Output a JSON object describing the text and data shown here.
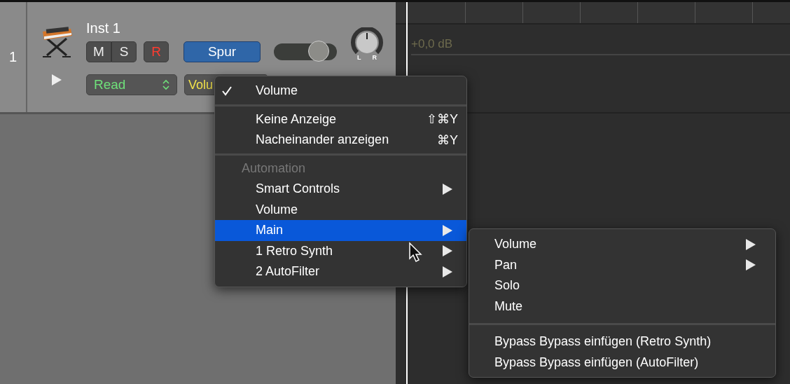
{
  "track": {
    "number": "1",
    "name": "Inst 1",
    "mute": "M",
    "solo": "S",
    "record": "R",
    "track_button": "Spur",
    "fader": {
      "level": 0.71
    },
    "pan": {
      "left": "L",
      "right": "R"
    },
    "automation_mode": "Read",
    "automation_parameter": "Volu"
  },
  "timeline": {
    "gain_label": "+0,0 dB"
  },
  "menu": {
    "items": [
      {
        "kind": "item",
        "label": "Volume",
        "checked": true,
        "selected": false
      },
      {
        "kind": "separator"
      },
      {
        "kind": "item",
        "label": "Keine Anzeige",
        "shortcut": "⇧⌘Y",
        "checked": false,
        "selected": false
      },
      {
        "kind": "item",
        "label": "Nacheinander anzeigen",
        "shortcut": "⌘Y",
        "checked": false,
        "selected": false
      },
      {
        "kind": "separator"
      },
      {
        "kind": "header",
        "label": "Automation"
      },
      {
        "kind": "item",
        "label": "Smart Controls",
        "submenu": true,
        "checked": false,
        "selected": false
      },
      {
        "kind": "item",
        "label": "Volume",
        "checked": false,
        "selected": false
      },
      {
        "kind": "item",
        "label": "Main",
        "submenu": true,
        "checked": false,
        "selected": true
      },
      {
        "kind": "item",
        "label": "1 Retro Synth",
        "submenu": true,
        "checked": false,
        "selected": false
      },
      {
        "kind": "item",
        "label": "2 AutoFilter",
        "submenu": true,
        "checked": false,
        "selected": false
      }
    ]
  },
  "submenu": {
    "items": [
      {
        "kind": "item",
        "label": "Volume",
        "submenu": true,
        "selected": false
      },
      {
        "kind": "item",
        "label": "Pan",
        "submenu": true,
        "selected": false
      },
      {
        "kind": "item",
        "label": "Solo",
        "selected": false
      },
      {
        "kind": "item",
        "label": "Mute",
        "selected": false
      },
      {
        "kind": "separator"
      },
      {
        "kind": "item",
        "label": "Bypass Bypass einfügen (Retro Synth)",
        "selected": false
      },
      {
        "kind": "item",
        "label": "Bypass Bypass einfügen (AutoFilter)",
        "selected": false
      }
    ]
  }
}
